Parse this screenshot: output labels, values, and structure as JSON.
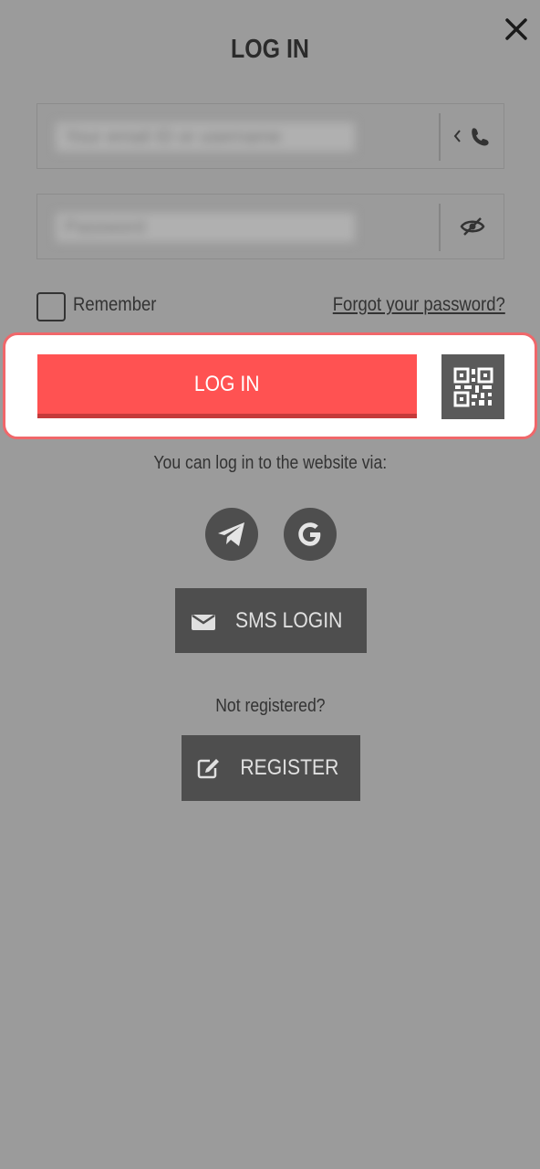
{
  "header": {
    "title": "LOG IN"
  },
  "form": {
    "login_placeholder": "Your email ID or username",
    "password_placeholder": "Password",
    "remember_label": "Remember",
    "forgot_label": "Forgot your password?",
    "login_button": "LOG IN"
  },
  "alternatives": {
    "via_text": "You can log in to the website via:",
    "social": [
      "telegram-icon",
      "google-icon"
    ],
    "sms_button": "SMS LOGIN"
  },
  "register": {
    "prompt": "Not registered?",
    "button": "REGISTER"
  },
  "colors": {
    "accent": "#ff5252",
    "dark_button": "#4e4e4e",
    "overlay": "#9b9b9b"
  }
}
